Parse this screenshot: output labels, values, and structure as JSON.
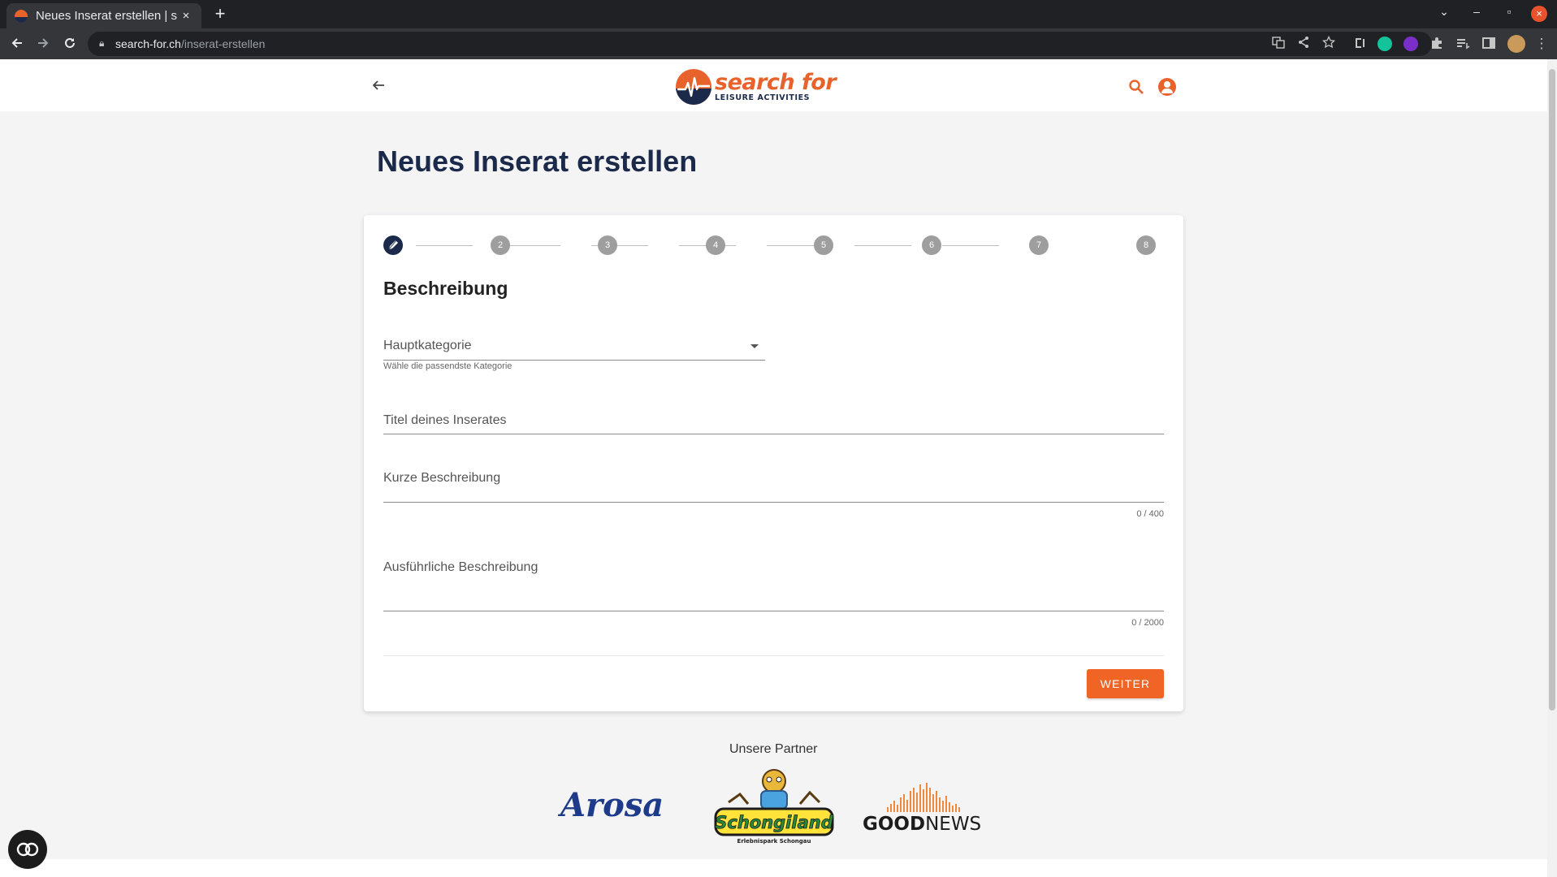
{
  "browser": {
    "tab_title": "Neues Inserat erstellen | s",
    "tab_close": "×",
    "new_tab": "+",
    "url_host": "search-for.ch",
    "url_path": "/inserat-erstellen",
    "window_close": "×"
  },
  "site": {
    "logo_big": "search for",
    "logo_small": "LEISURE ACTIVITIES",
    "brand_color": "#e8622c",
    "navy_color": "#1b2a4a"
  },
  "page": {
    "title": "Neues Inserat erstellen"
  },
  "stepper": {
    "steps": [
      "",
      "2",
      "3",
      "4",
      "5",
      "6",
      "7",
      "8"
    ],
    "active_step": 1
  },
  "form": {
    "section_title": "Beschreibung",
    "category_label": "Hauptkategorie",
    "category_hint": "Wähle die passendste Kategorie",
    "title_label": "Titel deines Inserates",
    "short_label": "Kurze Beschreibung",
    "short_counter": "0 / 400",
    "long_label": "Ausführliche Beschreibung",
    "long_counter": "0 / 2000",
    "next_button": "WEITER"
  },
  "partners": {
    "title": "Unsere Partner",
    "arosa": "Arosa",
    "schongiland": "Schongiland",
    "schongiland_sub": "Erlebnispark Schongau",
    "goodnews_bold": "GOOD",
    "goodnews_light": "NEWS"
  }
}
